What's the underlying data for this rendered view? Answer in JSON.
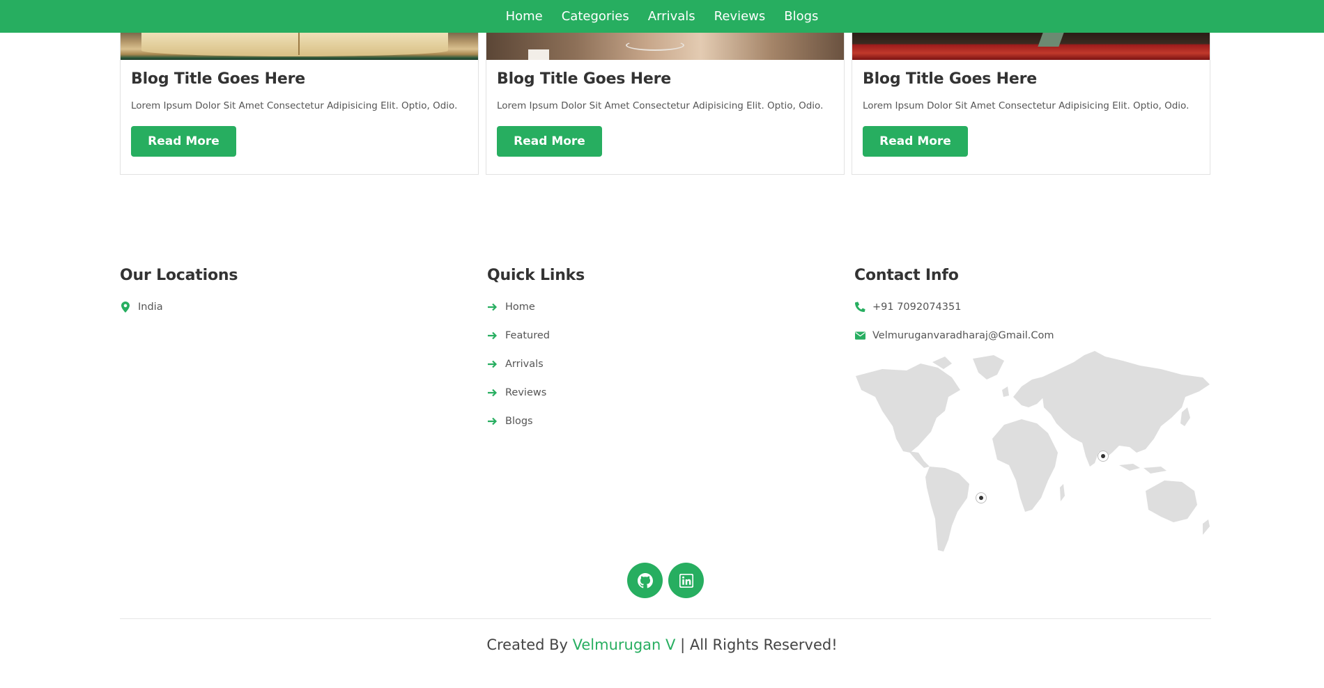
{
  "nav": {
    "items": [
      {
        "label": "Home"
      },
      {
        "label": "Categories"
      },
      {
        "label": "Arrivals"
      },
      {
        "label": "Reviews"
      },
      {
        "label": "Blogs"
      }
    ]
  },
  "blogs": [
    {
      "title": "Blog Title Goes Here",
      "text": "Lorem Ipsum Dolor Sit Amet Consectetur Adipisicing Elit. Optio, Odio.",
      "button": "Read More"
    },
    {
      "title": "Blog Title Goes Here",
      "text": "Lorem Ipsum Dolor Sit Amet Consectetur Adipisicing Elit. Optio, Odio.",
      "button": "Read More"
    },
    {
      "title": "Blog Title Goes Here",
      "text": "Lorem Ipsum Dolor Sit Amet Consectetur Adipisicing Elit. Optio, Odio.",
      "button": "Read More"
    }
  ],
  "footer": {
    "locations": {
      "heading": "Our Locations",
      "items": [
        "India"
      ]
    },
    "quick_links": {
      "heading": "Quick Links",
      "items": [
        "Home",
        "Featured",
        "Arrivals",
        "Reviews",
        "Blogs"
      ]
    },
    "contact": {
      "heading": "Contact Info",
      "phone": "+91 7092074351",
      "email": "Velmuruganvaradharaj@Gmail.Com"
    },
    "social": [
      {
        "icon": "github-icon"
      },
      {
        "icon": "linkedin-icon"
      }
    ],
    "credit_prefix": "Created By",
    "credit_name": "Velmurugan V",
    "credit_suffix": "| All Rights Reserved!"
  },
  "colors": {
    "accent": "#27ae60",
    "text": "#333333",
    "muted": "#555555",
    "map": "#dedede"
  }
}
